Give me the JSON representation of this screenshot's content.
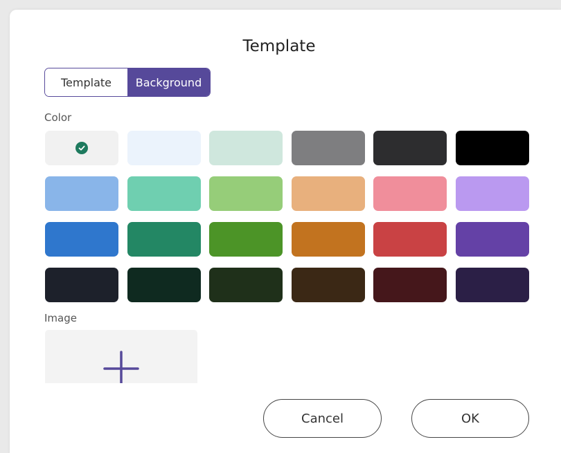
{
  "dialog": {
    "title": "Template"
  },
  "tabs": [
    {
      "label": "Template",
      "active": false
    },
    {
      "label": "Background",
      "active": true
    }
  ],
  "color_section": {
    "label": "Color",
    "selected_index": 0,
    "swatches": [
      "#f1f1f1",
      "#ebf3fc",
      "#cfe7dd",
      "#7e7e80",
      "#2d2d2f",
      "#000000",
      "#89b5e9",
      "#6fcfb0",
      "#96cd79",
      "#e8b07d",
      "#f08e9b",
      "#ba99f0",
      "#2f77cd",
      "#238764",
      "#4c9427",
      "#c2731f",
      "#c94244",
      "#6441a6",
      "#1d212b",
      "#0f2a20",
      "#1f301a",
      "#3b2815",
      "#45171b",
      "#2b1f46"
    ]
  },
  "image_section": {
    "label": "Image",
    "add_icon": "plus-icon"
  },
  "buttons": {
    "cancel_label": "Cancel",
    "ok_label": "OK"
  },
  "colors": {
    "accent": "#56499a",
    "check": "#1e7a5e"
  }
}
